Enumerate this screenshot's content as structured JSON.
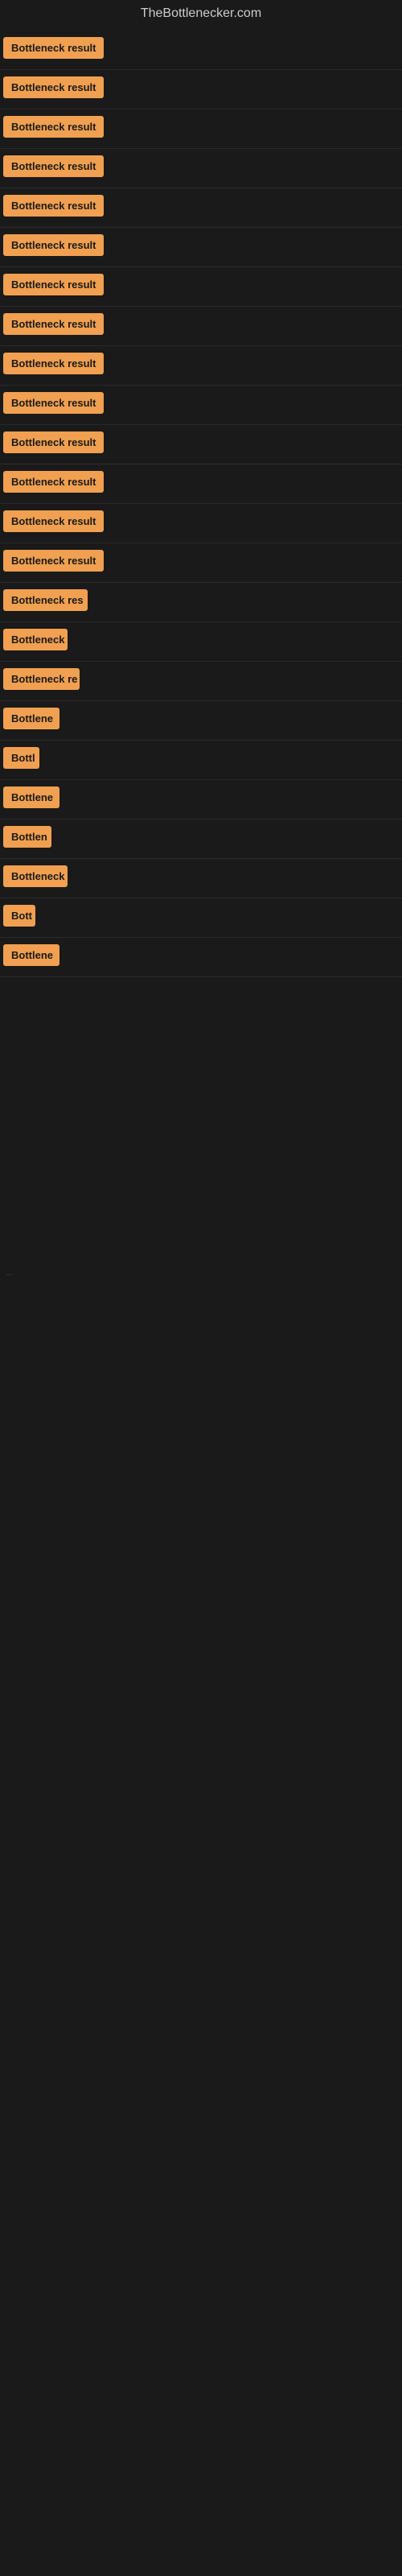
{
  "site": {
    "title": "TheBottlenecker.com"
  },
  "rows": [
    {
      "id": 1,
      "label": "Bottleneck result",
      "width": 130
    },
    {
      "id": 2,
      "label": "Bottleneck result",
      "width": 130
    },
    {
      "id": 3,
      "label": "Bottleneck result",
      "width": 130
    },
    {
      "id": 4,
      "label": "Bottleneck result",
      "width": 130
    },
    {
      "id": 5,
      "label": "Bottleneck result",
      "width": 130
    },
    {
      "id": 6,
      "label": "Bottleneck result",
      "width": 130
    },
    {
      "id": 7,
      "label": "Bottleneck result",
      "width": 130
    },
    {
      "id": 8,
      "label": "Bottleneck result",
      "width": 130
    },
    {
      "id": 9,
      "label": "Bottleneck result",
      "width": 130
    },
    {
      "id": 10,
      "label": "Bottleneck result",
      "width": 130
    },
    {
      "id": 11,
      "label": "Bottleneck result",
      "width": 130
    },
    {
      "id": 12,
      "label": "Bottleneck result",
      "width": 130
    },
    {
      "id": 13,
      "label": "Bottleneck result",
      "width": 130
    },
    {
      "id": 14,
      "label": "Bottleneck result",
      "width": 130
    },
    {
      "id": 15,
      "label": "Bottleneck res",
      "width": 105
    },
    {
      "id": 16,
      "label": "Bottleneck",
      "width": 80
    },
    {
      "id": 17,
      "label": "Bottleneck re",
      "width": 95
    },
    {
      "id": 18,
      "label": "Bottlene",
      "width": 70
    },
    {
      "id": 19,
      "label": "Bottl",
      "width": 45
    },
    {
      "id": 20,
      "label": "Bottlene",
      "width": 70
    },
    {
      "id": 21,
      "label": "Bottlen",
      "width": 60
    },
    {
      "id": 22,
      "label": "Bottleneck",
      "width": 80
    },
    {
      "id": 23,
      "label": "Bott",
      "width": 40
    },
    {
      "id": 24,
      "label": "Bottlene",
      "width": 70
    }
  ],
  "footer_text": "..."
}
